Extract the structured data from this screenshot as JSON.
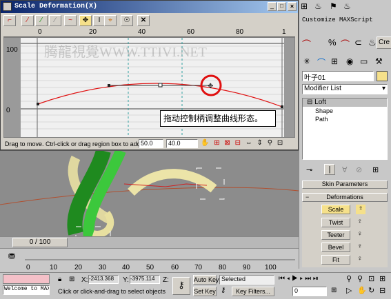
{
  "dialog": {
    "title": "Scale Deformation(X)",
    "ruler_ticks": [
      "0",
      "20",
      "40",
      "60",
      "80",
      "1"
    ],
    "y_labels": [
      "100",
      "0"
    ],
    "watermark": "腾龍視覺WWW.TTIVI.NET",
    "callout": "拖动控制柄调整曲线形态。",
    "status": "Drag to move. Ctrl-click or drag region box to add to s",
    "field1": "50.0",
    "field2": "40.0"
  },
  "right_panel": {
    "menu_customize": "Customize",
    "menu_maxscript": "MAXScript",
    "create_tab": "Cre",
    "object_name": "叶子01",
    "modifier_list": "Modifier List",
    "stack": [
      "Loft",
      "Shape",
      "Path"
    ],
    "rollout_skin": "Skin Parameters",
    "rollout_deform": "Deformations",
    "deform_buttons": [
      "Scale",
      "Twist",
      "Teeter",
      "Bevel",
      "Fit"
    ]
  },
  "viewport": {
    "frame_counter": "0 / 100"
  },
  "timeline": {
    "ticks": [
      "0",
      "10",
      "20",
      "30",
      "40",
      "50",
      "60",
      "70",
      "80",
      "90",
      "100"
    ]
  },
  "statusbar": {
    "welcome": "Welcome to MAX:",
    "x_label": "X:",
    "x_value": "-2413.368",
    "y_label": "Y:",
    "y_value": "-3975.114",
    "z_label": "Z:",
    "prompt": "Click or click-and-drag to select objects",
    "auto_key": "Auto Key",
    "selected": "Selected",
    "set_key": "Set Key",
    "key_filters": "Key Filters...",
    "frame_value": "0"
  },
  "colors": {
    "curve": "#e01010",
    "titlebar": "#0a246a",
    "highlight": "#f5e08a"
  }
}
